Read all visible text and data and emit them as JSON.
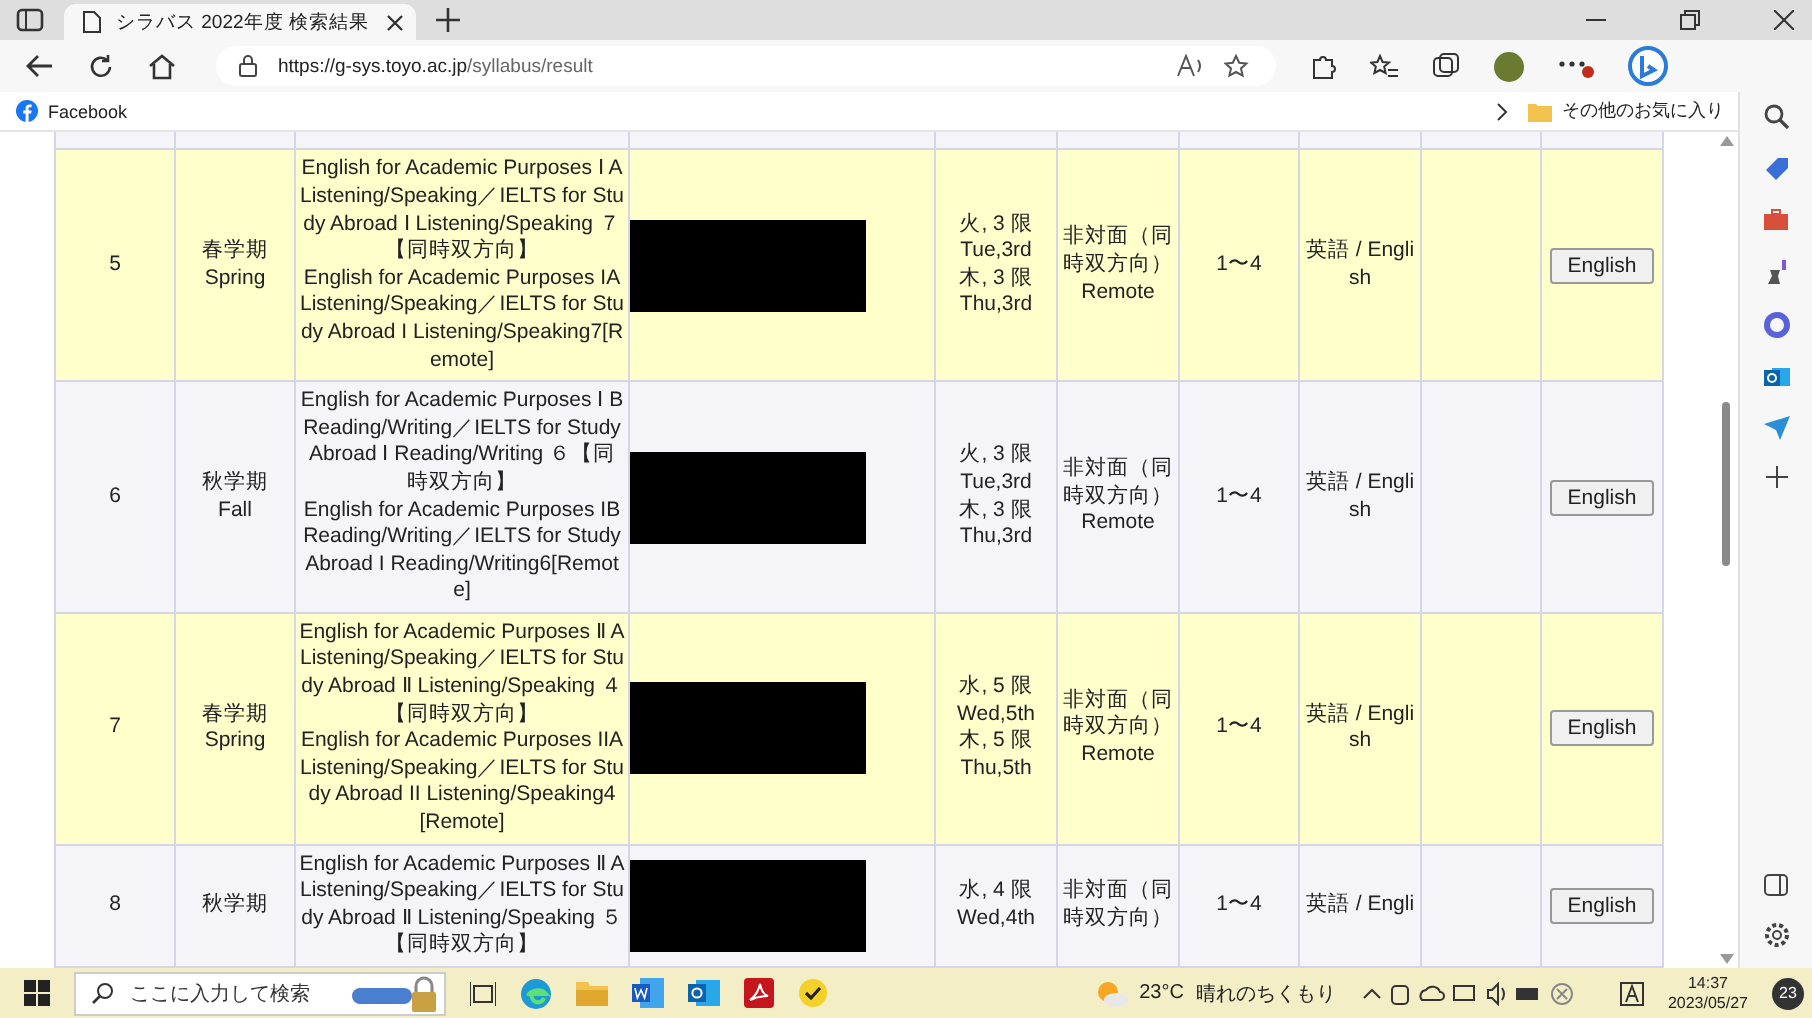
{
  "browser": {
    "tab_title": "シラバス 2022年度 検索結果",
    "url_host": "https://g-sys.toyo.ac.jp",
    "url_path": "/syllabus/result",
    "bookmark": "Facebook",
    "other_favorites": "その他のお気に入り"
  },
  "table": {
    "rows": [
      {
        "no": "5",
        "term": [
          "春学期",
          "Spring"
        ],
        "title_ja": "English for Academic Purposes Ⅰ A Listening/Speaking／IELTS for Study Abroad Ⅰ Listening/Speaking ７【同時双方向】",
        "title_en": "English for Academic Purposes IA Listening/Speaking／IELTS for Study Abroad I Listening/Speaking7[Remote]",
        "time": [
          "火, 3 限",
          "Tue,3rd",
          "木, 3 限",
          "Thu,3rd"
        ],
        "mode_ja": "非対面（同時双方向）",
        "mode_en": "Remote",
        "year": "1〜4",
        "language": "英語 / English",
        "button": "English"
      },
      {
        "no": "6",
        "term": [
          "秋学期",
          "Fall"
        ],
        "title_ja": "English for Academic Purposes Ⅰ B Reading/Writing／IELTS for Study Abroad Ⅰ Reading/Writing ６【同時双方向】",
        "title_en": "English for Academic Purposes IB Reading/Writing／IELTS for Study Abroad I Reading/Writing6[Remote]",
        "time": [
          "火, 3 限",
          "Tue,3rd",
          "木, 3 限",
          "Thu,3rd"
        ],
        "mode_ja": "非対面（同時双方向）",
        "mode_en": "Remote",
        "year": "1〜4",
        "language": "英語 / English",
        "button": "English"
      },
      {
        "no": "7",
        "term": [
          "春学期",
          "Spring"
        ],
        "title_ja": "English for Academic Purposes Ⅱ A Listening/Speaking／IELTS for Study Abroad Ⅱ Listening/Speaking ４【同時双方向】",
        "title_en": "English for Academic Purposes IIA Listening/Speaking／IELTS for Study Abroad II Listening/Speaking4[Remote]",
        "time": [
          "水, 5 限",
          "Wed,5th",
          "木, 5 限",
          "Thu,5th"
        ],
        "mode_ja": "非対面（同時双方向）",
        "mode_en": "Remote",
        "year": "1〜4",
        "language": "英語 / English",
        "button": "English"
      },
      {
        "no": "8",
        "term": [
          "秋学期"
        ],
        "title_ja": "English for Academic Purposes Ⅱ A Listening/Speaking／IELTS for Study Abroad Ⅱ Listening/Speaking ５【同時双方向】",
        "time": [
          "水, 4 限",
          "Wed,4th"
        ],
        "mode_ja": "非対面（同時双方向）",
        "year": "1〜4",
        "language": "英語 / Engli",
        "button": "English"
      }
    ]
  },
  "taskbar": {
    "search_placeholder": "ここに入力して検索",
    "temperature": "23°C",
    "weather": "晴れのちくもり",
    "time": "14:37",
    "date": "2023/05/27",
    "notifications": "23"
  }
}
